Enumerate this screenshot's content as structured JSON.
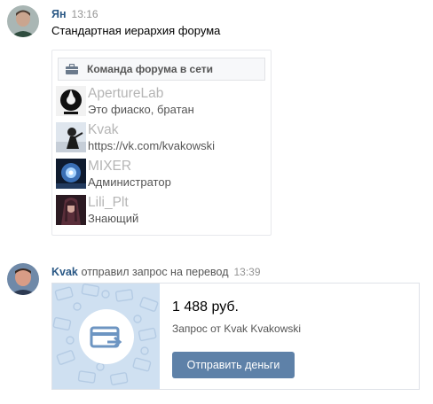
{
  "msg1": {
    "author": "Ян",
    "time": "13:16",
    "text": "Стандартная иерархия форума"
  },
  "widget": {
    "title": "Команда форума в сети",
    "members": [
      {
        "name": "ApertureLab",
        "role": "Это фиаско, братан"
      },
      {
        "name": "Kvak",
        "role": "https://vk.com/kvakowski"
      },
      {
        "name": "MIXER",
        "role": "Администратор"
      },
      {
        "name": "Lili_Plt",
        "role": "Знающий"
      }
    ]
  },
  "msg2": {
    "author": "Kvak",
    "action": "отправил запрос на перевод",
    "time": "13:39"
  },
  "transfer": {
    "amount": "1 488 руб.",
    "request": "Запрос от Kvak Kvakowski",
    "button": "Отправить деньги"
  },
  "colors": {
    "link": "#2a5885",
    "button": "#5e81a8",
    "card_bg": "#cfe0f1"
  }
}
